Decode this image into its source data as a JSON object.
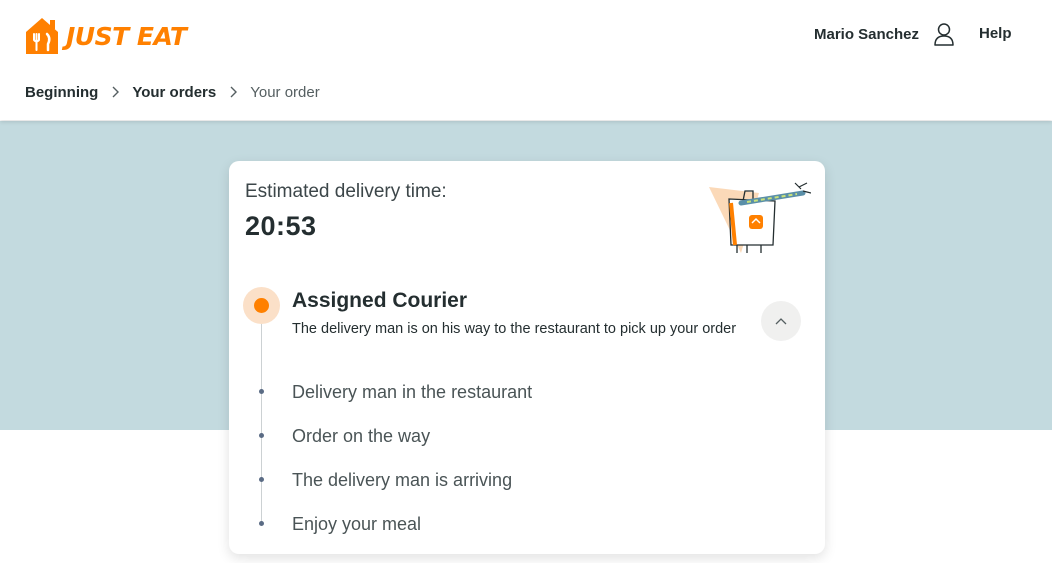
{
  "header": {
    "logo_text": "JUST EAT",
    "user_name": "Mario Sanchez",
    "help_label": "Help"
  },
  "breadcrumb": [
    {
      "label": "Beginning"
    },
    {
      "label": "Your orders"
    },
    {
      "label": "Your order"
    }
  ],
  "delivery": {
    "estimated_label": "Estimated delivery time:",
    "estimated_time": "20:53"
  },
  "tracking": {
    "active_step": {
      "title": "Assigned Courier",
      "description": "The delivery man is on his way to the restaurant to pick up your order"
    },
    "steps": [
      {
        "label": "Delivery man in the restaurant"
      },
      {
        "label": "Order on the way"
      },
      {
        "label": "The delivery man is arriving"
      },
      {
        "label": "Enjoy your meal"
      }
    ]
  },
  "colors": {
    "brand_orange": "#ff8000",
    "band_bg": "#c3dadf"
  },
  "icons": {
    "user": "user-icon",
    "chevron_up": "chevron-up-icon",
    "chevron_right": "chevron-right-icon"
  }
}
